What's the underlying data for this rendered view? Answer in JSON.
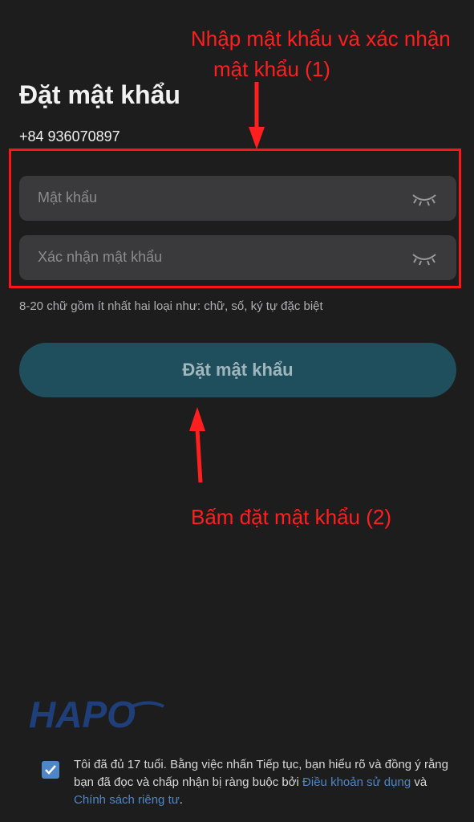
{
  "screen": {
    "title": "Đặt mật khẩu",
    "phone": "+84 936070897",
    "password_placeholder": "Mật khẩu",
    "confirm_placeholder": "Xác nhận mật khẩu",
    "hint": "8-20 chữ gồm ít nhất hai loại như: chữ, số, ký tự đặc biệt",
    "submit_label": "Đặt mật khẩu"
  },
  "annotations": {
    "step1_line1": "Nhập mật khẩu và xác nhận",
    "step1_line2": "mật khẩu (1)",
    "step2": "Bấm đặt mật khẩu (2)",
    "color": "#ff1f1f"
  },
  "footer": {
    "logo_text": "HAPO",
    "checkbox_checked": true,
    "terms_text": "Tôi đã đủ 17 tuổi. Bằng việc nhấn Tiếp tục, bạn hiểu rõ và đồng ý rằng bạn đã đọc và chấp nhận bị ràng buộc bởi ",
    "terms_link": "Điều khoản sử dụng",
    "and_text": " và ",
    "privacy_link": "Chính sách riêng tư",
    "end_text": "."
  },
  "icons": [
    "eye-closed-icon",
    "check-icon"
  ],
  "colors": {
    "background": "#1d1d1e",
    "button": "#1f4f5c",
    "link": "#4e86c7",
    "highlight": "#ff1515"
  }
}
